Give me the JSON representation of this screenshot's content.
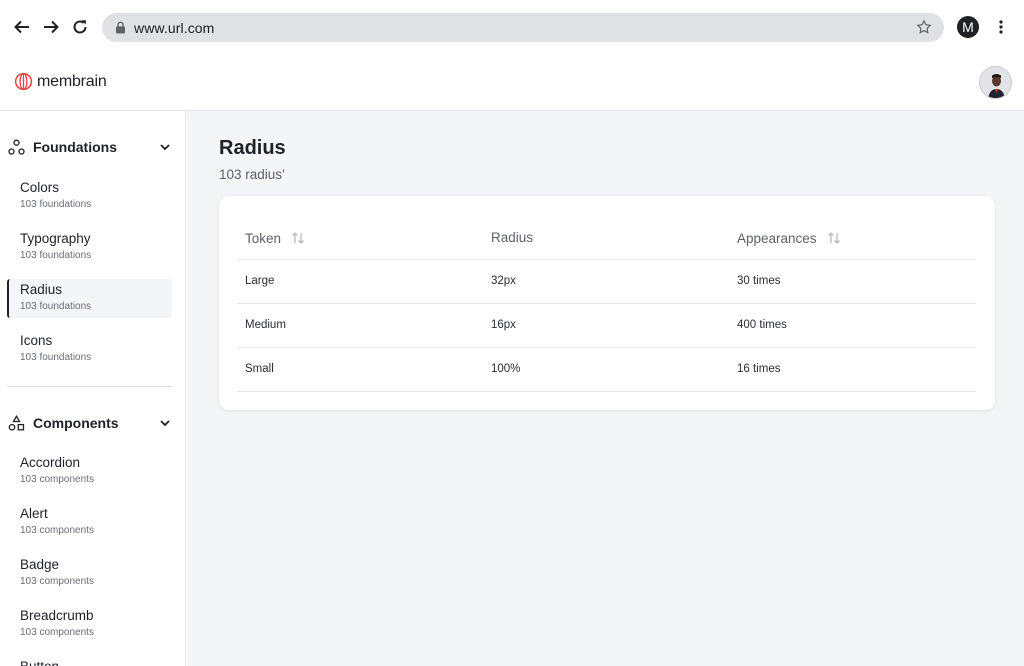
{
  "browser": {
    "url": "www.url.com",
    "profile_initial": "M"
  },
  "app": {
    "logo_text": "membrain"
  },
  "sidebar": {
    "foundations": {
      "title": "Foundations",
      "items": [
        {
          "label": "Colors",
          "sub": "103 foundations"
        },
        {
          "label": "Typography",
          "sub": "103 foundations"
        },
        {
          "label": "Radius",
          "sub": "103 foundations"
        },
        {
          "label": "Icons",
          "sub": "103 foundations"
        }
      ]
    },
    "components": {
      "title": "Components",
      "items": [
        {
          "label": "Accordion",
          "sub": "103 components"
        },
        {
          "label": "Alert",
          "sub": "103 components"
        },
        {
          "label": "Badge",
          "sub": "103 components"
        },
        {
          "label": "Breadcrumb",
          "sub": "103 components"
        },
        {
          "label": "Button",
          "sub": ""
        }
      ]
    }
  },
  "main": {
    "title": "Radius",
    "subtitle": "103 radius’",
    "table": {
      "columns": [
        "Token",
        "Radius",
        "Appearances"
      ],
      "rows": [
        [
          "Large",
          "32px",
          "30 times"
        ],
        [
          "Medium",
          "16px",
          "400 times"
        ],
        [
          "Small",
          "100%",
          "16 times"
        ]
      ]
    }
  },
  "icons": {
    "back": "arrow-left-icon",
    "forward": "arrow-right-icon",
    "reload": "reload-icon",
    "lock": "lock-icon",
    "star": "star-icon",
    "more": "more-vertical-icon",
    "foundations": "foundations-icon",
    "components": "components-icon",
    "chevron": "chevron-down-icon",
    "sort": "sort-icon"
  },
  "colors": {
    "accent": "#e8453c",
    "text": "#1f2129",
    "muted": "#5d6069",
    "background": "#f4f5f7"
  }
}
